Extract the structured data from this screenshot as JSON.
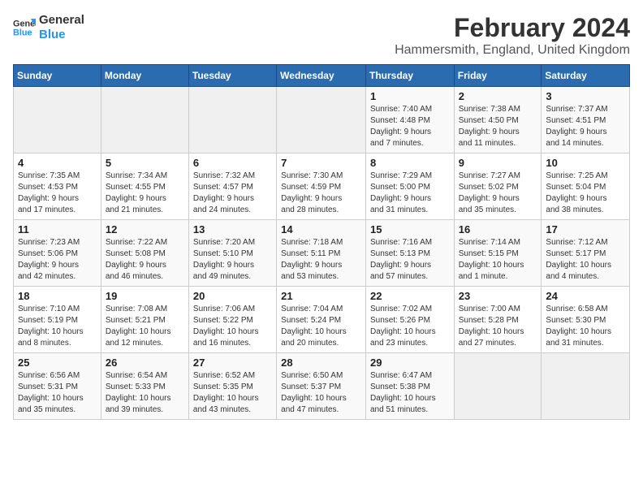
{
  "logo": {
    "text_general": "General",
    "text_blue": "Blue"
  },
  "title": "February 2024",
  "subtitle": "Hammersmith, England, United Kingdom",
  "days_of_week": [
    "Sunday",
    "Monday",
    "Tuesday",
    "Wednesday",
    "Thursday",
    "Friday",
    "Saturday"
  ],
  "weeks": [
    [
      {
        "day": "",
        "info": ""
      },
      {
        "day": "",
        "info": ""
      },
      {
        "day": "",
        "info": ""
      },
      {
        "day": "",
        "info": ""
      },
      {
        "day": "1",
        "info": "Sunrise: 7:40 AM\nSunset: 4:48 PM\nDaylight: 9 hours\nand 7 minutes."
      },
      {
        "day": "2",
        "info": "Sunrise: 7:38 AM\nSunset: 4:50 PM\nDaylight: 9 hours\nand 11 minutes."
      },
      {
        "day": "3",
        "info": "Sunrise: 7:37 AM\nSunset: 4:51 PM\nDaylight: 9 hours\nand 14 minutes."
      }
    ],
    [
      {
        "day": "4",
        "info": "Sunrise: 7:35 AM\nSunset: 4:53 PM\nDaylight: 9 hours\nand 17 minutes."
      },
      {
        "day": "5",
        "info": "Sunrise: 7:34 AM\nSunset: 4:55 PM\nDaylight: 9 hours\nand 21 minutes."
      },
      {
        "day": "6",
        "info": "Sunrise: 7:32 AM\nSunset: 4:57 PM\nDaylight: 9 hours\nand 24 minutes."
      },
      {
        "day": "7",
        "info": "Sunrise: 7:30 AM\nSunset: 4:59 PM\nDaylight: 9 hours\nand 28 minutes."
      },
      {
        "day": "8",
        "info": "Sunrise: 7:29 AM\nSunset: 5:00 PM\nDaylight: 9 hours\nand 31 minutes."
      },
      {
        "day": "9",
        "info": "Sunrise: 7:27 AM\nSunset: 5:02 PM\nDaylight: 9 hours\nand 35 minutes."
      },
      {
        "day": "10",
        "info": "Sunrise: 7:25 AM\nSunset: 5:04 PM\nDaylight: 9 hours\nand 38 minutes."
      }
    ],
    [
      {
        "day": "11",
        "info": "Sunrise: 7:23 AM\nSunset: 5:06 PM\nDaylight: 9 hours\nand 42 minutes."
      },
      {
        "day": "12",
        "info": "Sunrise: 7:22 AM\nSunset: 5:08 PM\nDaylight: 9 hours\nand 46 minutes."
      },
      {
        "day": "13",
        "info": "Sunrise: 7:20 AM\nSunset: 5:10 PM\nDaylight: 9 hours\nand 49 minutes."
      },
      {
        "day": "14",
        "info": "Sunrise: 7:18 AM\nSunset: 5:11 PM\nDaylight: 9 hours\nand 53 minutes."
      },
      {
        "day": "15",
        "info": "Sunrise: 7:16 AM\nSunset: 5:13 PM\nDaylight: 9 hours\nand 57 minutes."
      },
      {
        "day": "16",
        "info": "Sunrise: 7:14 AM\nSunset: 5:15 PM\nDaylight: 10 hours\nand 1 minute."
      },
      {
        "day": "17",
        "info": "Sunrise: 7:12 AM\nSunset: 5:17 PM\nDaylight: 10 hours\nand 4 minutes."
      }
    ],
    [
      {
        "day": "18",
        "info": "Sunrise: 7:10 AM\nSunset: 5:19 PM\nDaylight: 10 hours\nand 8 minutes."
      },
      {
        "day": "19",
        "info": "Sunrise: 7:08 AM\nSunset: 5:21 PM\nDaylight: 10 hours\nand 12 minutes."
      },
      {
        "day": "20",
        "info": "Sunrise: 7:06 AM\nSunset: 5:22 PM\nDaylight: 10 hours\nand 16 minutes."
      },
      {
        "day": "21",
        "info": "Sunrise: 7:04 AM\nSunset: 5:24 PM\nDaylight: 10 hours\nand 20 minutes."
      },
      {
        "day": "22",
        "info": "Sunrise: 7:02 AM\nSunset: 5:26 PM\nDaylight: 10 hours\nand 23 minutes."
      },
      {
        "day": "23",
        "info": "Sunrise: 7:00 AM\nSunset: 5:28 PM\nDaylight: 10 hours\nand 27 minutes."
      },
      {
        "day": "24",
        "info": "Sunrise: 6:58 AM\nSunset: 5:30 PM\nDaylight: 10 hours\nand 31 minutes."
      }
    ],
    [
      {
        "day": "25",
        "info": "Sunrise: 6:56 AM\nSunset: 5:31 PM\nDaylight: 10 hours\nand 35 minutes."
      },
      {
        "day": "26",
        "info": "Sunrise: 6:54 AM\nSunset: 5:33 PM\nDaylight: 10 hours\nand 39 minutes."
      },
      {
        "day": "27",
        "info": "Sunrise: 6:52 AM\nSunset: 5:35 PM\nDaylight: 10 hours\nand 43 minutes."
      },
      {
        "day": "28",
        "info": "Sunrise: 6:50 AM\nSunset: 5:37 PM\nDaylight: 10 hours\nand 47 minutes."
      },
      {
        "day": "29",
        "info": "Sunrise: 6:47 AM\nSunset: 5:38 PM\nDaylight: 10 hours\nand 51 minutes."
      },
      {
        "day": "",
        "info": ""
      },
      {
        "day": "",
        "info": ""
      }
    ]
  ]
}
